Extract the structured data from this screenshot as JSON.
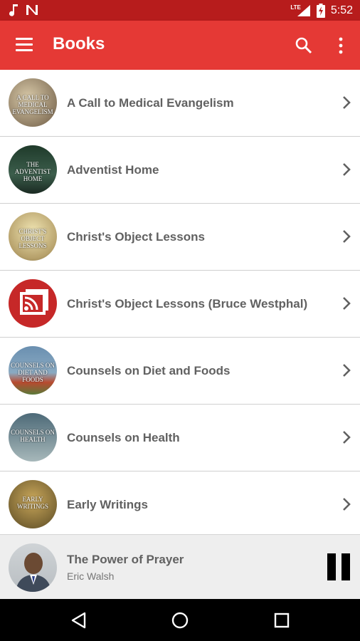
{
  "status_bar": {
    "time": "5:52",
    "network_label": "LTE",
    "icons": [
      "music-note-icon",
      "n-notification-icon",
      "signal-icon",
      "battery-charging-icon"
    ]
  },
  "app_bar": {
    "title": "Books",
    "icons": [
      "menu-icon",
      "search-icon",
      "more-vert-icon"
    ]
  },
  "books": [
    {
      "title": "A Call to Medical Evangelism",
      "thumb_text": "A CALL TO MEDICAL EVANGELISM",
      "thumb_colors": [
        "#6d5a44",
        "#d8c9a8"
      ]
    },
    {
      "title": "Adventist Home",
      "thumb_text": "THE ADVENTIST HOME",
      "thumb_colors": [
        "#1f3a2a",
        "#3c5e4c"
      ]
    },
    {
      "title": "Christ's Object Lessons",
      "thumb_text": "CHRIST'S OBJECT LESSONS",
      "thumb_colors": [
        "#b6a06a",
        "#e6d79e"
      ]
    },
    {
      "title": "Christ's Object Lessons (Bruce Westphal)",
      "thumb_text": "",
      "thumb_colors": [
        "#c62828",
        "#c62828"
      ],
      "thumb_icon": "rss-book-icon"
    },
    {
      "title": "Counsels on Diet and Foods",
      "thumb_text": "COUNSELS ON DIET AND FOODS",
      "thumb_colors": [
        "#6a8fb0",
        "#b94a2f"
      ]
    },
    {
      "title": "Counsels on Health",
      "thumb_text": "COUNSELS ON HEALTH",
      "thumb_colors": [
        "#4d6a78",
        "#a7b8ba"
      ]
    },
    {
      "title": "Early Writings",
      "thumb_text": "EARLY WRITINGS",
      "thumb_colors": [
        "#5a4a24",
        "#c9a75a"
      ]
    }
  ],
  "now_playing": {
    "title": "The Power of Prayer",
    "artist": "Eric Walsh",
    "control": "pause-icon"
  },
  "nav_bar": {
    "icons": [
      "back-icon",
      "home-icon",
      "recents-icon"
    ]
  },
  "colors": {
    "status_bar": "#b71c1c",
    "app_bar": "#e53935",
    "row_text": "#616161",
    "player_bg": "#eeeeee"
  }
}
